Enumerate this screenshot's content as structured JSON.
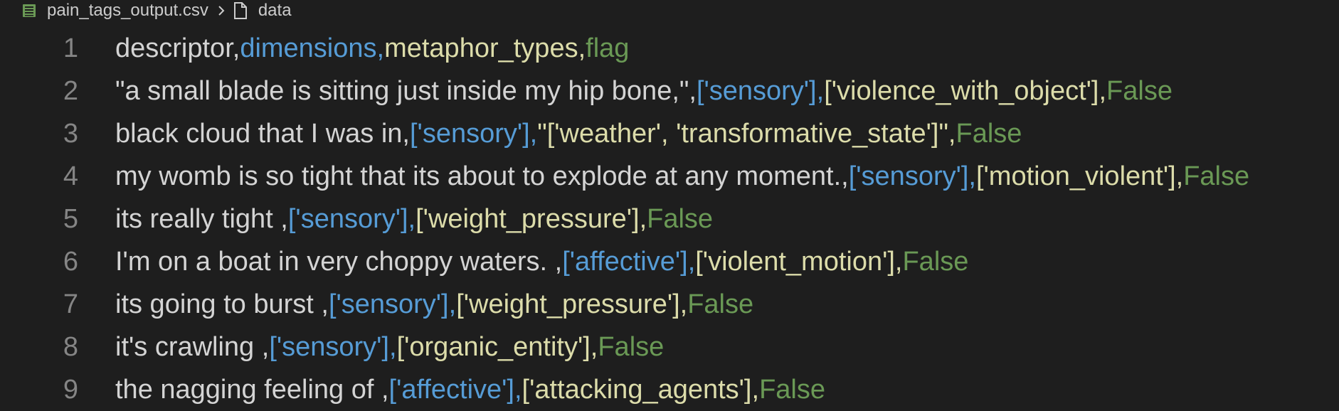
{
  "breadcrumb": {
    "file_name": "pain_tags_output.csv",
    "symbol": "data"
  },
  "colors": {
    "background": "#1e1e1e",
    "column1": "#d4d4d4",
    "column2": "#569cd6",
    "column3": "#dcdcaa",
    "column4": "#6a9955",
    "line_number": "#858585",
    "csv_icon": "#6a9955"
  },
  "icons": {
    "file": "table-icon",
    "chevron": "chevron-right-icon",
    "symbol": "file-icon"
  },
  "lines": [
    {
      "n": "1",
      "c1": "descriptor,",
      "c2": "dimensions,",
      "c3": "metaphor_types,",
      "c4": "flag"
    },
    {
      "n": "2",
      "c1": "\"a small blade is sitting just inside my hip bone,\",",
      "c2": "['sensory'],",
      "c3": "['violence_with_object'],",
      "c4": "False"
    },
    {
      "n": "3",
      "c1": "black cloud that I was in,",
      "c2": "['sensory'],",
      "c3": "\"['weather', 'transformative_state']\",",
      "c4": "False"
    },
    {
      "n": "4",
      "c1": "my womb is so tight that its about to explode at any moment.,",
      "c2": "['sensory'],",
      "c3": "['motion_violent'],",
      "c4": "False"
    },
    {
      "n": "5",
      "c1": "its really tight ,",
      "c2": "['sensory'],",
      "c3": "['weight_pressure'],",
      "c4": "False"
    },
    {
      "n": "6",
      "c1": "I'm on a boat in very choppy waters. ,",
      "c2": "['affective'],",
      "c3": "['violent_motion'],",
      "c4": "False"
    },
    {
      "n": "7",
      "c1": "its going to burst ,",
      "c2": "['sensory'],",
      "c3": "['weight_pressure'],",
      "c4": "False"
    },
    {
      "n": "8",
      "c1": "it's crawling ,",
      "c2": "['sensory'],",
      "c3": "['organic_entity'],",
      "c4": "False"
    },
    {
      "n": "9",
      "c1": "the nagging feeling of ,",
      "c2": "['affective'],",
      "c3": "['attacking_agents'],",
      "c4": "False"
    }
  ]
}
